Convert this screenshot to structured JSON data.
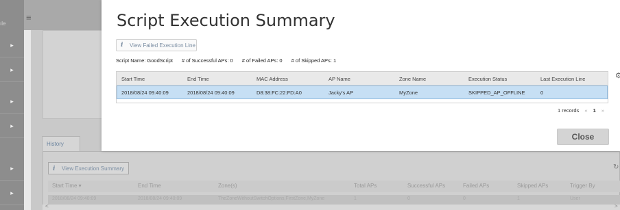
{
  "background": {
    "side_label": "ıle",
    "menu_icon": "hamburger-icon",
    "sidebar_items": [
      "▸",
      "▸",
      "▸",
      "▸",
      "▸",
      "▸",
      "▸"
    ],
    "history_tab": "History",
    "view_summary_btn": "View Execution Summary",
    "table_headers": [
      "Start Time ▾",
      "End Time",
      "Zone(s)",
      "Total APs",
      "Successful APs",
      "Failed APs",
      "Skipped APs",
      "Trigger By"
    ],
    "table_row": [
      "2018/08/24 09:40:09",
      "2018/08/24 09:40:09",
      "TheZoneWithoutSwitchOptions,FirstZone,MyZone",
      "1",
      "0",
      "0",
      "1",
      "User"
    ],
    "scroll_left": "<",
    "scroll_right": ">"
  },
  "modal": {
    "title": "Script Execution Summary",
    "view_failed_btn": "View Failed Execution Line",
    "summary": {
      "script_name": "Script Name: GoodScript",
      "successful": "# of Successful APs: 0",
      "failed": "# of Failed APs: 0",
      "skipped": "# of Skipped APs: 1"
    },
    "columns": [
      "Start Time",
      "End Time",
      "MAC Address",
      "AP Name",
      "Zone Name",
      "Execution Status",
      "Last Execution Line"
    ],
    "rows": [
      [
        "2018/08/24 09:40:09",
        "2018/08/24 09:40:09",
        "D8:38:FC:22:FD:A0",
        "Jacky's AP",
        "MyZone",
        "SKIPPED_AP_OFFLINE",
        "0"
      ]
    ],
    "records": "1 records",
    "pager_prev": "«",
    "page": "1",
    "pager_next": "»",
    "close_label": "Close"
  }
}
